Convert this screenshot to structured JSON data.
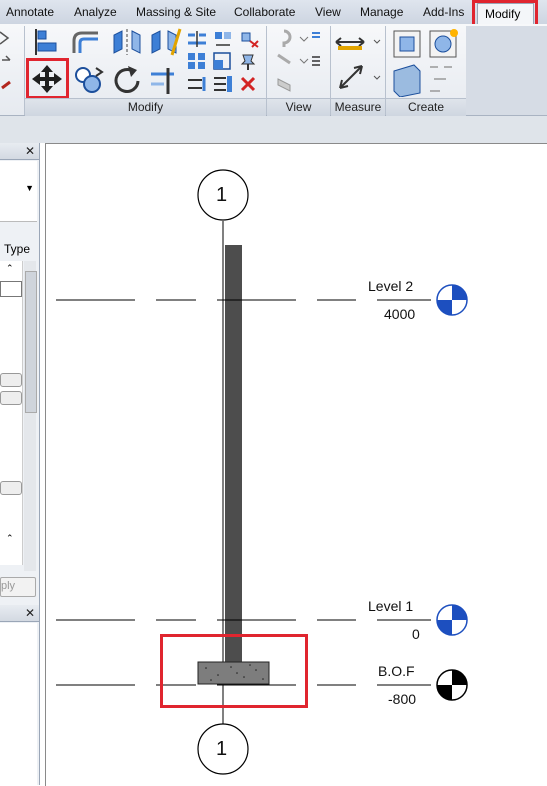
{
  "tabs": [
    {
      "label": "Annotate"
    },
    {
      "label": "Analyze"
    },
    {
      "label": "Massing & Site"
    },
    {
      "label": "Collaborate"
    },
    {
      "label": "View"
    },
    {
      "label": "Manage"
    },
    {
      "label": "Add-Ins"
    },
    {
      "label": "Modify",
      "selected": true
    }
  ],
  "panels": {
    "modify": "Modify",
    "view": "View",
    "measure": "Measure",
    "create": "Create"
  },
  "properties": {
    "type_label": "Type",
    "apply_label": "ply"
  },
  "drawing": {
    "grid_top": "1",
    "grid_bottom": "1",
    "levels": [
      {
        "name": "Level 2",
        "elevation": "4000"
      },
      {
        "name": "Level 1",
        "elevation": "0"
      },
      {
        "name": "B.O.F",
        "elevation": "-800"
      }
    ]
  },
  "colors": {
    "highlight": "#e0252f",
    "level_marker": "#1d4fbf",
    "column": "#4d4d4d"
  }
}
